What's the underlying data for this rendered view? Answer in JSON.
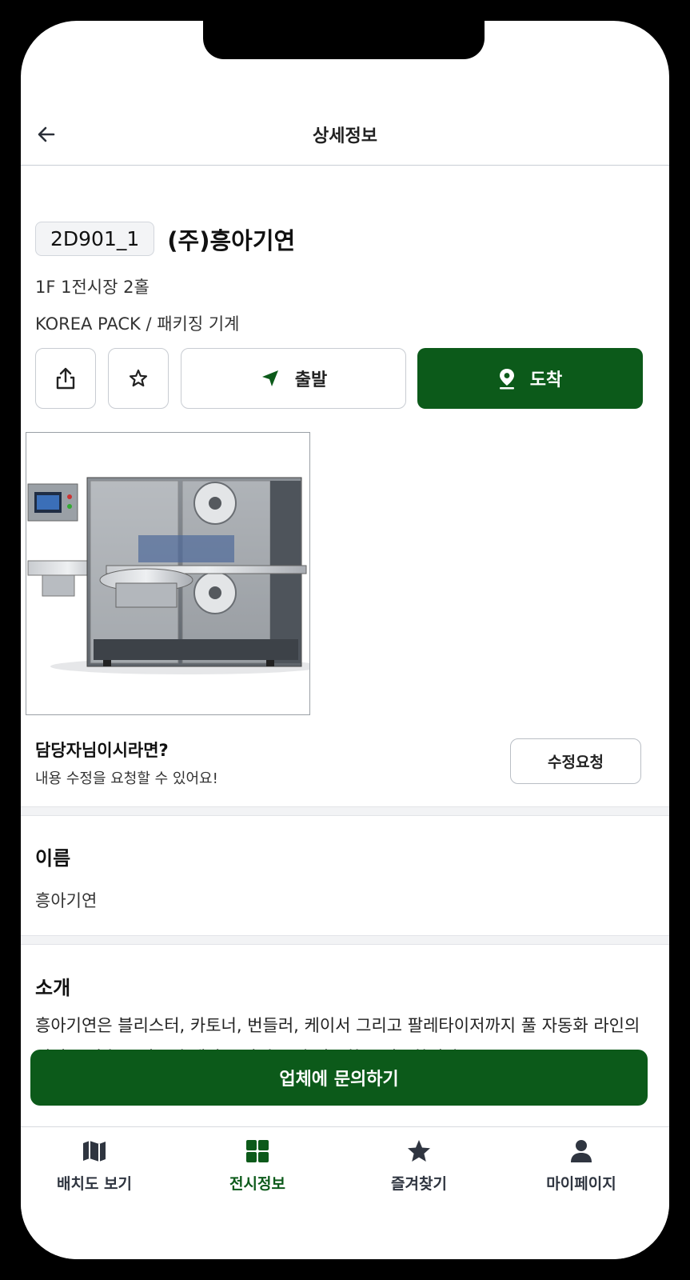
{
  "header": {
    "title": "상세정보"
  },
  "booth": {
    "code": "2D901_1",
    "company": "(주)흥아기연",
    "location": "1F 1전시장 2홀",
    "category": "KOREA PACK / 패키징 기계"
  },
  "actions": {
    "depart_label": "출발",
    "arrive_label": "도착"
  },
  "owner": {
    "title": "담당자님이시라면?",
    "subtitle": "내용 수정을 요청할 수 있어요!",
    "edit_label": "수정요청"
  },
  "name_section": {
    "heading": "이름",
    "value": "흥아기연"
  },
  "intro_section": {
    "heading": "소개",
    "text": "흥아기연은 블리스터, 카토너, 번들러, 케이서 그리고 팔레타이저까지 풀 자동화 라인의 설비를 갖추고 있으며 제약 분야의 포장 자동화를 선도합니다."
  },
  "cta": {
    "label": "업체에 문의하기"
  },
  "tabbar": {
    "items": [
      {
        "label": "배치도 보기",
        "icon": "map-icon"
      },
      {
        "label": "전시정보",
        "icon": "grid-icon",
        "active": true
      },
      {
        "label": "즐겨찾기",
        "icon": "star-icon"
      },
      {
        "label": "마이페이지",
        "icon": "person-icon"
      }
    ]
  },
  "colors": {
    "accent": "#0c5a1a",
    "text": "#1a1a1a",
    "divider": "#f2f3f5"
  }
}
